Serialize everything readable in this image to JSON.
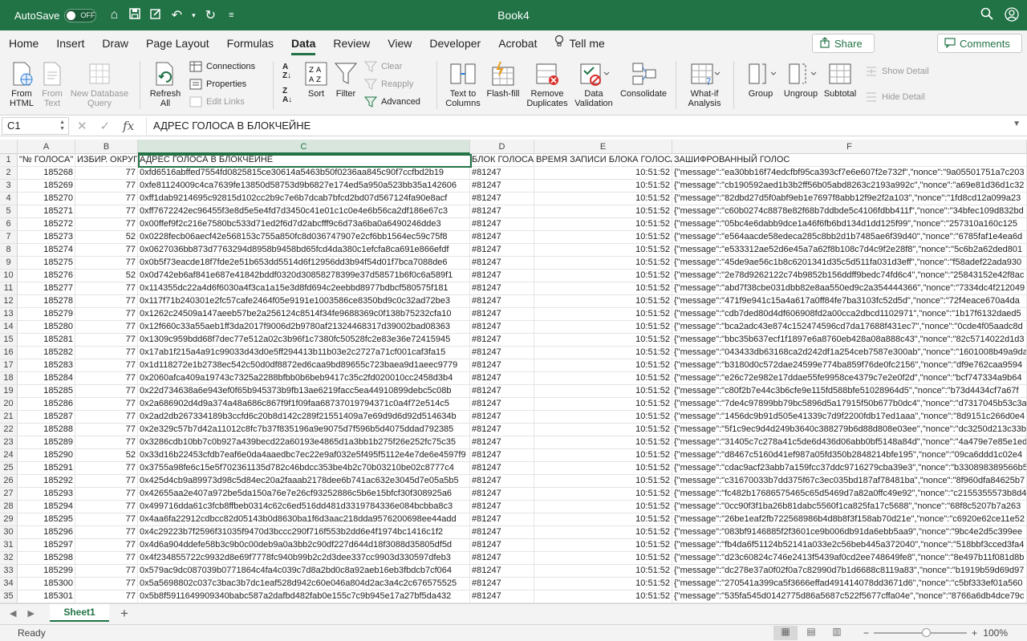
{
  "titlebar": {
    "autosave_label": "AutoSave",
    "autosave_state": "OFF",
    "document_title": "Book4"
  },
  "tabs": [
    "Home",
    "Insert",
    "Draw",
    "Page Layout",
    "Formulas",
    "Data",
    "Review",
    "View",
    "Developer",
    "Acrobat"
  ],
  "active_tab": "Data",
  "tell_me": "Tell me",
  "share_label": "Share",
  "comments_label": "Comments",
  "ribbon": {
    "from_html": [
      "From",
      "HTML"
    ],
    "from_text": [
      "From",
      "Text"
    ],
    "new_database_query": [
      "New Database",
      "Query"
    ],
    "refresh_all": [
      "Refresh",
      "All"
    ],
    "connections": "Connections",
    "properties": "Properties",
    "edit_links": "Edit Links",
    "sort": "Sort",
    "filter": "Filter",
    "clear": "Clear",
    "reapply": "Reapply",
    "advanced": "Advanced",
    "text_to_columns": [
      "Text to",
      "Columns"
    ],
    "flash_fill": "Flash-fill",
    "remove_duplicates": [
      "Remove",
      "Duplicates"
    ],
    "data_validation": [
      "Data",
      "Validation"
    ],
    "consolidate": "Consolidate",
    "what_if_analysis": [
      "What-if",
      "Analysis"
    ],
    "group": "Group",
    "ungroup": "Ungroup",
    "subtotal": "Subtotal",
    "show_detail": "Show Detail",
    "hide_detail": "Hide Detail"
  },
  "formula_bar": {
    "name_box": "C1",
    "fx": "fx",
    "formula": "АДРЕС ГОЛОСА В БЛОКЧЕЙНЕ"
  },
  "grid": {
    "columns": [
      "A",
      "B",
      "C",
      "D",
      "E",
      "F"
    ],
    "selected_column": "C",
    "header_row": [
      "\"№ ГОЛОСА\"",
      "ИЗБИР. ОКРУГ",
      "АДРЕС ГОЛОСА В БЛОКЧЕЙНЕ",
      "БЛОК ГОЛОСА",
      "ВРЕМЯ ЗАПИСИ БЛОКА ГОЛОСА",
      "ЗАШИФРОВАННЫЙ ГОЛОС"
    ],
    "rows": [
      [
        "185268",
        "77",
        "0xfd6516abffed7554fd0825815ce30614a5463b50f0236aa845c90f7ccfbd2b19",
        "#81247",
        "10:51:52",
        "{\"message\":\"ea30bb16f74edcfbf95ca393cf7e6e607f2e732f\",\"nonce\":\"9a05501751a7c203"
      ],
      [
        "185269",
        "77",
        "0xfe81124009c4ca7639fe13850d58753d9b6827e174ed5a950a523bb35a142606",
        "#81247",
        "10:51:52",
        "{\"message\":\"cb190592aed1b3b2ff56b05abd8263c2193a992c\",\"nonce\":\"a69e81d36d1c32"
      ],
      [
        "185270",
        "77",
        "0xff1dab9214695c92815d102cc2b9c7e6b7dcab7bfcd2bd07d567124fa90e8acf",
        "#81247",
        "10:51:52",
        "{\"message\":\"82dbd27d5f0abf9eb1e7697f8abb12f9e2f2a103\",\"nonce\":\"1fd8cd12a099a23"
      ],
      [
        "185271",
        "77",
        "0xff7672242ec96455f3e8d5e5e4fd7d3450c41e01c1c0e4e6b56ca2df186e67c3",
        "#81247",
        "10:51:52",
        "{\"message\":\"c60b0274c8878e82f68b7ddbde5c4106fdbb411f\",\"nonce\":\"34bfec109d832bd"
      ],
      [
        "185272",
        "77",
        "0x00ffef9f2c216e7580bc533d71ed2f6d7d2abcfff9c6d73a6ba0a6490246dde3",
        "#81247",
        "10:51:52",
        "{\"message\":\"05bc4e6dabb9dce1a46f6fb6bd134d1dd125f99\",\"nonce\":\"257310a160c125"
      ],
      [
        "185273",
        "52",
        "0x0228fecb06aecf42e568153c755a850fc8d036747907e2cf6bb1564ec59c75f8",
        "#81247",
        "10:51:52",
        "{\"message\":\"e564aacde58edeca285c8bb2d1b7485ae6f39d40\",\"nonce\":\"6785faf1e4ea6d"
      ],
      [
        "185274",
        "77",
        "0x0627036bb873d7763294d8958b9458bd65fcd4da380c1efcfa8ca691e866efdf",
        "#81247",
        "10:51:52",
        "{\"message\":\"e533312ae52d6e45a7a62f8b108c7d4c9f2e28f8\",\"nonce\":\"5c6b2a62ded801"
      ],
      [
        "185275",
        "77",
        "0x0b5f73eacde18f7fde2e51b653dd5514d6f12956dd3b94f54d01f7bca7088de6",
        "#81247",
        "10:51:52",
        "{\"message\":\"45de9ae56c1b8c6201341d35c5d511fa031d3eff\",\"nonce\":\"f58adef22ada930"
      ],
      [
        "185276",
        "52",
        "0x0d742eb6af841e687e41842bddf0320d30858278399e37d58571b6f0c6a589f1",
        "#81247",
        "10:51:52",
        "{\"message\":\"2e78d9262122c74b9852b156ddff9bedc74fd6c4\",\"nonce\":\"25843152e42f8ac"
      ],
      [
        "185277",
        "77",
        "0x114355dc22a4d6f6030a4f3ca1a15e3d8fd694c2eebbd8977bdbcf580575f181",
        "#81247",
        "10:51:52",
        "{\"message\":\"abd7f38cbe031dbb82e8aa550ed9c2a354444366\",\"nonce\":\"7334dc4f212049"
      ],
      [
        "185278",
        "77",
        "0x117f71b240301e2fc57cafe2464f05e9191e1003586ce8350bd9c0c32ad72be3",
        "#81247",
        "10:51:52",
        "{\"message\":\"471f9e941c15a4a617a0ff84fe7ba3103fc52d5d\",\"nonce\":\"72f4eace670a4da"
      ],
      [
        "185279",
        "77",
        "0x1262c24509a147aeeb57be2a256124c8514f34fe9688369c0f138b75232cfa10",
        "#81247",
        "10:51:52",
        "{\"message\":\"cdb7ded80d4df606908fd2a00cca2dbcd1102971\",\"nonce\":\"1b17f6132daed5"
      ],
      [
        "185280",
        "77",
        "0x12f660c33a55aeb1ff3da2017f9006d2b9780af21324468317d39002bad08363",
        "#81247",
        "10:51:52",
        "{\"message\":\"bca2adc43e874c152474596cd7da17688f431ec7\",\"nonce\":\"0cde4f05aadc8d"
      ],
      [
        "185281",
        "77",
        "0x1309c959bdd68f7dec77e512a02c3b96f1c7380fc50528fc2e83e36e72415945",
        "#81247",
        "10:51:52",
        "{\"message\":\"bbc35b637ecf1f1897e6a8760eb428a08a888c43\",\"nonce\":\"82c5714022d1d3"
      ],
      [
        "185282",
        "77",
        "0x17ab1f215a4a91c99033d43d0e5ff294413b11b03e2c2727a71cf001caf3fa15",
        "#81247",
        "10:51:52",
        "{\"message\":\"043433db63168ca2d242df1a254ceb7587e300ab\",\"nonce\":\"1601008b49a9da"
      ],
      [
        "185283",
        "77",
        "0x1d118272e1b2738ec542c50d0df8872ed6caa9bd89655c723baea9d1aeec9779",
        "#81247",
        "10:51:52",
        "{\"message\":\"b3180d0c572dae24599e774ba859f76de0fc2156\",\"nonce\":\"df9e762caa9594"
      ],
      [
        "185284",
        "77",
        "0x2060afca409a19743c7325a2288bfbb0b6beb9417c35c2fd020010cc2458d3b4",
        "#81247",
        "10:51:52",
        "{\"message\":\"e26c72e982e17ddae55fe9958ce4379c7e2e0f2d\",\"nonce\":\"bcf747334a9b64"
      ],
      [
        "185285",
        "77",
        "0x22d734638a6e943ef0f65b945373b9fb13ae6219facc5ea44910899debc5c08b",
        "#81247",
        "10:51:52",
        "{\"message\":\"c80f2b7e44c3b6cfe9e115fd588bfe51028964d5\",\"nonce\":\"b73d4434cf7a67f"
      ],
      [
        "185286",
        "77",
        "0x2a686902d4d9a374a48a686c867f9f1f09faa68737019794371c0a4f72e514c5",
        "#81247",
        "10:51:52",
        "{\"message\":\"7de4c97899bb79bc5896d5a17915f50b677b0dc4\",\"nonce\":\"d7317045b53c3a"
      ],
      [
        "185287",
        "77",
        "0x2ad2db267334189b3ccfd6c20b8d142c289f21551409a7e69d9d6d92d514634b",
        "#81247",
        "10:51:52",
        "{\"message\":\"1456dc9b91d505e41339c7d9f2200fdb17ed1aaa\",\"nonce\":\"8d9151c266d0e4"
      ],
      [
        "185288",
        "77",
        "0x2e329c57b7d42a11012c8fc7b37f835196a9e9075d7f596b5d4075ddad792385",
        "#81247",
        "10:51:52",
        "{\"message\":\"5f1c9ec9d4d249b3640c388279b6d88d808e03ee\",\"nonce\":\"dc3250d213c33b"
      ],
      [
        "185289",
        "77",
        "0x3286cdb10bb7c0b927a439becd22a60193e4865d1a3bb1b275f26e252fc75c35",
        "#81247",
        "10:51:52",
        "{\"message\":\"31405c7c278a41c5de6d436d06abb0bf5148a84d\",\"nonce\":\"4a479e7e85e1ed"
      ],
      [
        "185290",
        "52",
        "0x33d16b22453cfdb7eaf6e0da4aaedbc7ec22e9af032e5f495f5112e4e7de6e4597f9",
        "#81247",
        "10:51:52",
        "{\"message\":\"d8467c5160d41ef987a05fd350b2848214bfe195\",\"nonce\":\"09ca6ddd1c02e4"
      ],
      [
        "185291",
        "77",
        "0x3755a98fe6c15e5f702361135d782c46bdcc353be4b2c70b03210be02c8777c4",
        "#81247",
        "10:51:52",
        "{\"message\":\"cdac9acf23abb7a159fcc37ddc9716279cba39e3\",\"nonce\":\"b330898389566b5"
      ],
      [
        "185292",
        "77",
        "0x425d4cb9a89973d98c5d84ec20a2faaab2178dee6b741ac632e3045d7e05a5b5",
        "#81247",
        "10:51:52",
        "{\"message\":\"c31670033b7dd375f67c3ec035bd187af78481ba\",\"nonce\":\"8f960dfa84625b7"
      ],
      [
        "185293",
        "77",
        "0x42655aa2e407a972be5da150a76e7e26cf93252886c5b6e15bfcf30f308925a6",
        "#81247",
        "10:51:52",
        "{\"message\":\"fc482b17686575465c65d5469d7a82a0ffc49e92\",\"nonce\":\"c2155355573b8d4"
      ],
      [
        "185294",
        "77",
        "0x499716dda61c3fcb8ffbeb0314c62c6ed516dd481d3319784336e084bcbba8c3",
        "#81247",
        "10:51:52",
        "{\"message\":\"0cc90f3f1ba26b81dabc5560f1ca825fa17c5688\",\"nonce\":\"68f8c5207b7a263"
      ],
      [
        "185295",
        "77",
        "0x4aa6fa22912cdbcc82d05143b0d8630ba1f6d3aac218dda9576200698ee44add",
        "#81247",
        "10:51:52",
        "{\"message\":\"26be1eaf2fb722568986b4d8b8f3f158ab70d21e\",\"nonce\":\"c6920e62ce11e52"
      ],
      [
        "185296",
        "77",
        "0x4c29223b7f2596f31035f9470d3bccc290f716f553b2dd6e4f1974bc1416c1f2",
        "#81247",
        "10:51:52",
        "{\"message\":\"083bf9146885f2f3601ce9b006db91da6ebb5aa9\",\"nonce\":\"9bc4e2d5c399ee"
      ],
      [
        "185297",
        "77",
        "0x4d6a904ddefe58b3c9b0c00deb9a0a3bb2c90df227d644d18f3088d35805df5d",
        "#81247",
        "10:51:52",
        "{\"message\":\"fb4da6f51124b52141a033e2c56beb445a372040\",\"nonce\":\"518bbf3cced3fa4"
      ],
      [
        "185298",
        "77",
        "0x4f234855722c9932d8e69f7778fc940b99b2c2d3dee337cc9903d330597dfeb3",
        "#81247",
        "10:51:52",
        "{\"message\":\"d23c60824c746e2413f5439af0cd2ee748649fe8\",\"nonce\":\"8e497b11f081d8b"
      ],
      [
        "185299",
        "77",
        "0x579ac9dc087039b0771864c4fa4c039c7d8a2bd0c8a92aeb16eb3fbdcb7cf064",
        "#81247",
        "10:51:52",
        "{\"message\":\"dc278e37a0f02f0a7c82990d7b1d6688c8119a83\",\"nonce\":\"b1919b59d69d97"
      ],
      [
        "185300",
        "77",
        "0x5a5698802c037c3bac3b7dc1eaf528d942c60e046a804d2ac3a4c2c676575525",
        "#81247",
        "10:51:52",
        "{\"message\":\"270541a399ca5f3666effad491414078dd3671d6\",\"nonce\":\"c5bf333ef01a560"
      ],
      [
        "185301",
        "77",
        "0x5b8f5911649909340babc587a2dafbd482fab0e155c7c9b945e17a27bf5da432",
        "#81247",
        "10:51:52",
        "{\"message\":\"535fa545d0142775d86a5687c522f5677cffa04e\",\"nonce\":\"8766a6db4dce79c"
      ]
    ]
  },
  "sheets": [
    "Sheet1"
  ],
  "status": {
    "ready": "Ready",
    "zoom": "100%"
  }
}
